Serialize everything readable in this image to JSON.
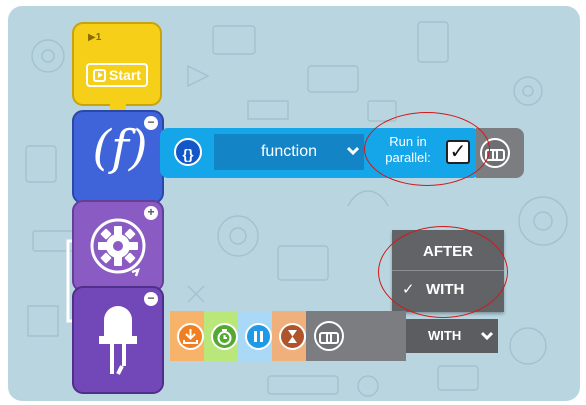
{
  "start_block": {
    "number": "▶1",
    "label": "Start"
  },
  "function_block": {
    "glyph": "(𝑓)",
    "collapse": "−"
  },
  "gear_block": {
    "expand": "+"
  },
  "led_block": {
    "collapse": "−"
  },
  "function_bar": {
    "braces": "{}",
    "selected_function": "function",
    "run_parallel_label_line1": "Run in",
    "run_parallel_label_line2": "parallel:",
    "run_parallel_checked": true,
    "check_mark": "✓"
  },
  "dropdown": {
    "items": [
      "AFTER",
      "WITH"
    ],
    "selected": "WITH",
    "check_mark": "✓"
  },
  "led_row": {
    "mode_select": "WITH",
    "chips": [
      "download-icon",
      "timer-icon",
      "pause-icon",
      "hourglass-icon",
      "link-icon"
    ]
  },
  "colors": {
    "canvas": "#b9d6e0",
    "start": "#f6cf19",
    "function": "#3f63d8",
    "gear": "#8a5cc3",
    "led": "#7248b9",
    "function_bar": "#14a6e8",
    "dropdown": "#616366",
    "highlight": "#d01818"
  }
}
